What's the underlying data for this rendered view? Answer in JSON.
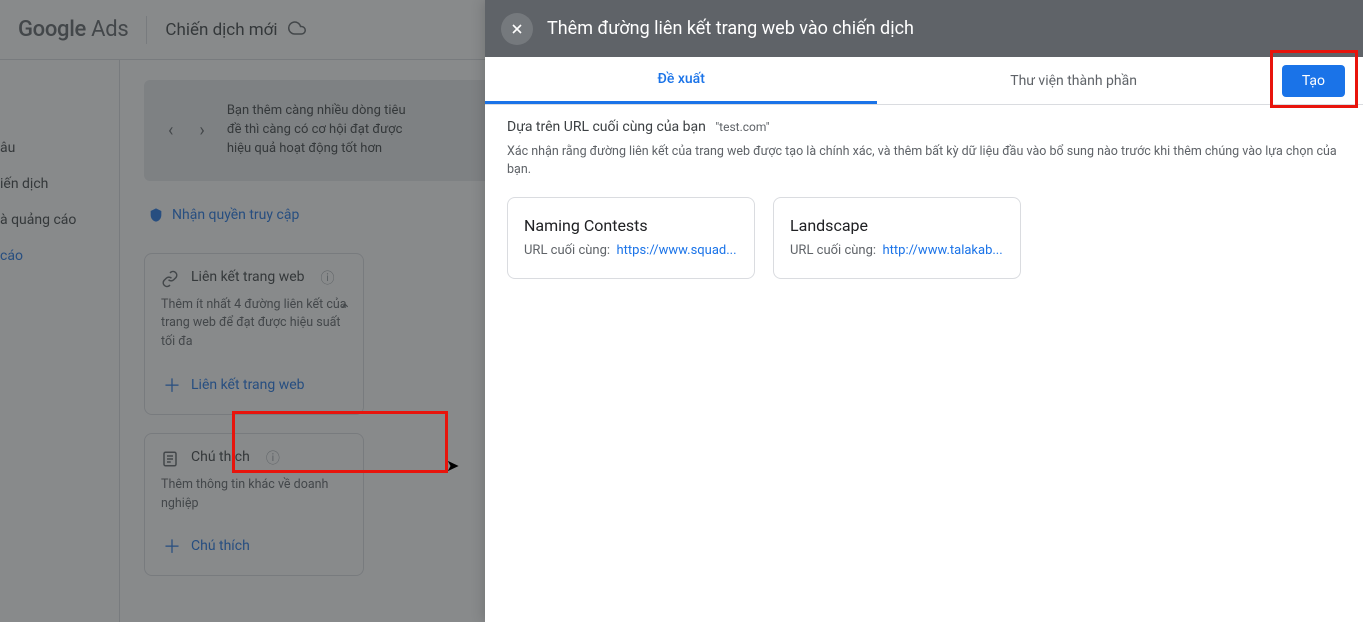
{
  "header": {
    "logo_bold": "Google",
    "logo_light": " Ads",
    "title": "Chiến dịch mới"
  },
  "sidebar": {
    "items": [
      {
        "label": "âu"
      },
      {
        "label": "iến dịch"
      },
      {
        "label": "à quảng cáo"
      },
      {
        "label": "cáo",
        "active": true
      }
    ]
  },
  "carousel": {
    "text": "Bạn thêm càng nhiều dòng tiêu đề thì càng có cơ hội đạt được hiệu quả hoạt động tốt hơn"
  },
  "access_link": "Nhận quyền truy cập",
  "card_sitelinks": {
    "title": "Liên kết trang web",
    "desc": "Thêm ít nhất 4 đường liên kết của trang web để đạt được hiệu suất tối đa",
    "add": "Liên kết trang web"
  },
  "card_callouts": {
    "title": "Chú thích",
    "desc": "Thêm thông tin khác về doanh nghiệp",
    "add": "Chú thích"
  },
  "panel": {
    "title": "Thêm đường liên kết trang web vào chiến dịch",
    "tabs": {
      "suggested": "Đề xuất",
      "library": "Thư viện thành phần"
    },
    "create_btn": "Tạo",
    "based_on": "Dựa trên URL cuối cùng của bạn",
    "based_on_url": "\"test.com\"",
    "confirm": "Xác nhận rằng đường liên kết của trang web được tạo là chính xác, và thêm bất kỳ dữ liệu đầu vào bổ sung nào trước khi thêm chúng vào lựa chọn của bạn.",
    "final_url_label": "URL cuối cùng:",
    "suggestions": [
      {
        "title": "Naming Contests",
        "url": "https://www.squad..."
      },
      {
        "title": "Landscape",
        "url": "http://www.talakab..."
      }
    ]
  }
}
